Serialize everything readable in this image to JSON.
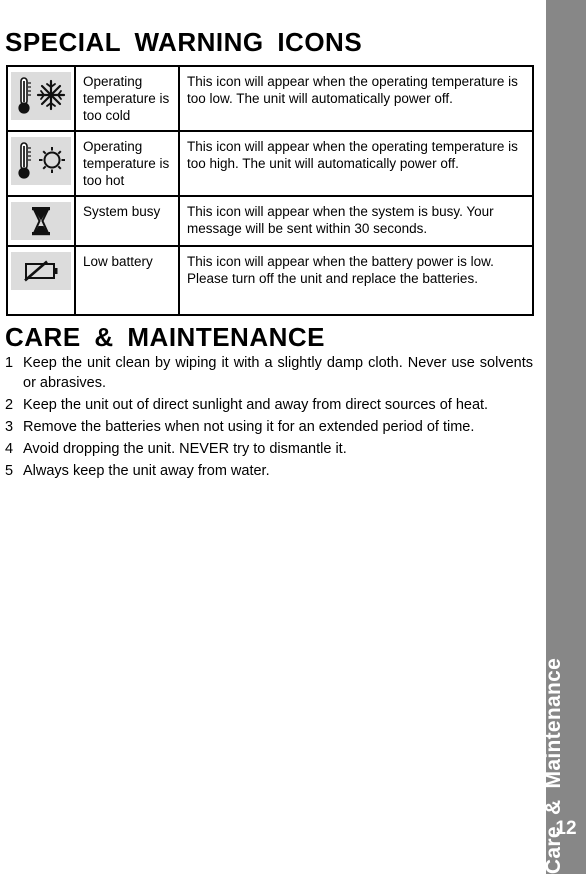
{
  "sections": {
    "warning_heading": "SPECIAL  WARNING  ICONS",
    "care_heading": "CARE  &  MAINTENANCE"
  },
  "warning_table": {
    "rows": [
      {
        "icon": "thermometer-snowflake-icon",
        "label": "Operating temperature is too cold",
        "description": "This icon will appear when the operating temperature is too low. The unit will automatically power off."
      },
      {
        "icon": "thermometer-sun-icon",
        "label": "Operating temperature is too hot",
        "description": "This icon will appear when the operating temperature is too high. The unit will automatically power off."
      },
      {
        "icon": "hourglass-icon",
        "label": "System busy",
        "description": "This icon will appear when the system is busy. Your message will be sent within 30 seconds."
      },
      {
        "icon": "low-battery-icon",
        "label": "Low battery",
        "description": "This icon will appear when the battery power is low. Please turn off the unit and replace the batteries."
      }
    ]
  },
  "care_list": {
    "items": [
      {
        "number": "1",
        "text": "Keep the unit clean by wiping it with a slightly damp cloth. Never use solvents or abrasives."
      },
      {
        "number": "2",
        "text": "Keep the unit out of direct sunlight and away from direct sources of heat."
      },
      {
        "number": "3",
        "text": "Remove the batteries when not using it for an extended period of time."
      },
      {
        "number": "4",
        "text": "Avoid dropping the unit. NEVER try to dismantle it."
      },
      {
        "number": "5",
        "text": "Always keep the unit away from water."
      }
    ]
  },
  "sidebar": {
    "label": "Care  &  Maintenance",
    "page_number": "12",
    "background_color": "#878787",
    "text_color": "#ffffff"
  },
  "colors": {
    "icon_background": "#dcdcdc",
    "table_border": "#000000",
    "page_background": "#ffffff"
  }
}
